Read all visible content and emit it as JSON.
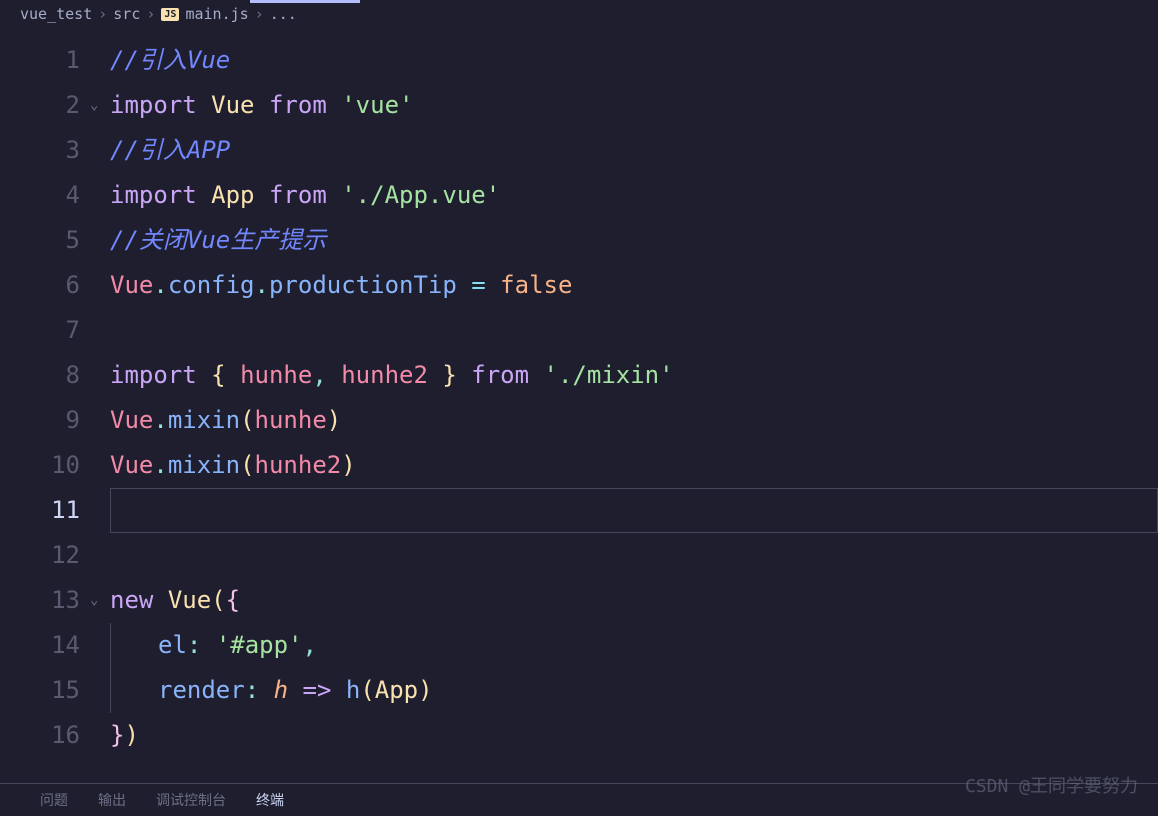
{
  "breadcrumb": {
    "root": "vue_test",
    "folder": "src",
    "icon": "JS",
    "file": "main.js",
    "trail": "..."
  },
  "lines": {
    "l1": {
      "num": "1",
      "comment": "//引入Vue"
    },
    "l2": {
      "num": "2",
      "kw": "import",
      "var": "Vue",
      "from": "from",
      "str": "'vue'"
    },
    "l3": {
      "num": "3",
      "comment": "//引入APP"
    },
    "l4": {
      "num": "4",
      "kw": "import",
      "var": "App",
      "from": "from",
      "str": "'./App.vue'"
    },
    "l5": {
      "num": "5",
      "comment": "//关闭Vue生产提示"
    },
    "l6": {
      "num": "6",
      "obj": "Vue",
      "p1": "config",
      "p2": "productionTip",
      "eq": "=",
      "val": "false"
    },
    "l7": {
      "num": "7"
    },
    "l8": {
      "num": "8",
      "kw": "import",
      "ob": "{",
      "v1": "hunhe",
      "c": ",",
      "v2": "hunhe2",
      "cb": "}",
      "from": "from",
      "str": "'./mixin'"
    },
    "l9": {
      "num": "9",
      "obj": "Vue",
      "fn": "mixin",
      "arg": "hunhe"
    },
    "l10": {
      "num": "10",
      "obj": "Vue",
      "fn": "mixin",
      "arg": "hunhe2"
    },
    "l11": {
      "num": "11"
    },
    "l12": {
      "num": "12"
    },
    "l13": {
      "num": "13",
      "kw": "new",
      "cls": "Vue",
      "op": "(",
      "ob": "{"
    },
    "l14": {
      "num": "14",
      "key": "el",
      "c": ":",
      "str": "'#app'",
      "comma": ","
    },
    "l15": {
      "num": "15",
      "key": "render",
      "c": ":",
      "param": "h",
      "arrow": "=>",
      "fn": "h",
      "arg": "App"
    },
    "l16": {
      "num": "16",
      "cb": "}",
      "cp": ")"
    }
  },
  "panel": {
    "t1": "问题",
    "t2": "输出",
    "t3": "调试控制台",
    "t4": "终端"
  },
  "watermark": "CSDN @王同学要努力"
}
